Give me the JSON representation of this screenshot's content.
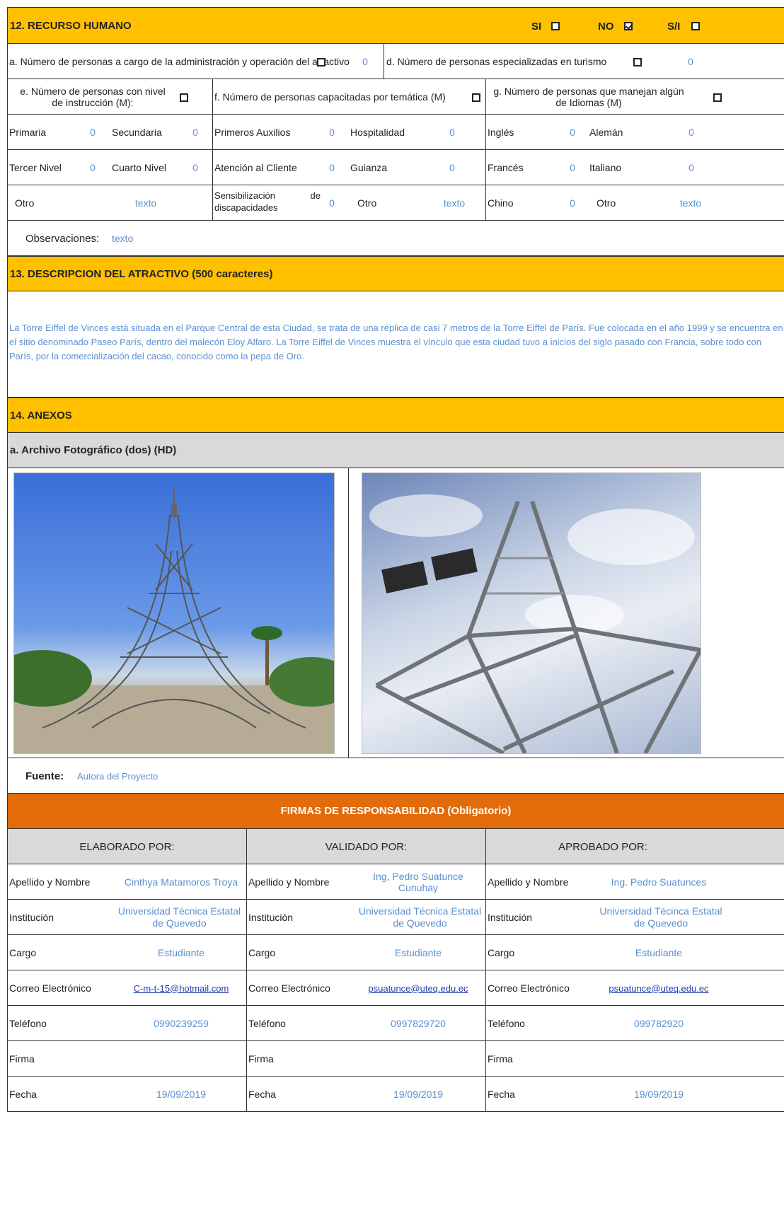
{
  "section12": {
    "title": "12. RECURSO HUMANO",
    "si_label": "SI",
    "no_label": "NO",
    "si_label_alt": "S/I"
  },
  "row_a": {
    "label_a": "a. Número de personas a cargo de la administración y operación del atractivo",
    "value_a": "0",
    "label_d": "d. Número de personas especializadas en turismo",
    "value_d": "0"
  },
  "row_efg": {
    "label_e": "e. Número de personas con nivel de instrucción (M):",
    "label_f": "f. Número de personas capacitadas por temática (M)",
    "label_g": "g. Número de personas que manejan algún de Idiomas (M)"
  },
  "grid": {
    "r1": [
      {
        "label": "Primaria",
        "value": "0"
      },
      {
        "label": "Secundaria",
        "value": "0"
      },
      {
        "label": "Primeros Auxilios",
        "value": "0"
      },
      {
        "label": "Hospitalidad",
        "value": "0"
      },
      {
        "label": "Inglés",
        "value": "0"
      },
      {
        "label": "Alemán",
        "value": "0"
      }
    ],
    "r2": [
      {
        "label": "Tercer Nivel",
        "value": "0"
      },
      {
        "label": "Cuarto Nivel",
        "value": "0"
      },
      {
        "label": "Atención al Cliente",
        "value": "0"
      },
      {
        "label": "Guianza",
        "value": "0"
      },
      {
        "label": "Francés",
        "value": "0"
      },
      {
        "label": "Italiano",
        "value": "0"
      }
    ],
    "r3": [
      {
        "label": "Otro",
        "value": "texto"
      },
      {
        "label": "Sensibilización de discapacidades",
        "value": "0"
      },
      {
        "label": "Otro",
        "value": "texto"
      },
      {
        "label": "Chino",
        "value": "0"
      },
      {
        "label": "Otro",
        "value": "texto"
      }
    ]
  },
  "observaciones": {
    "label": "Observaciones:",
    "value": "texto"
  },
  "section13": {
    "title": "13. DESCRIPCION DEL ATRACTIVO (500 caracteres)",
    "text": "La Torre Eiffel de Vinces está situada en el Parque Central de esta Ciudad, se trata de una réplica de casi 7 metros de la Torre Eiffel de París. Fue colocada en el año 1999 y se encuentra en el sitio denominado Paseo París, dentro del malecón Eloy Alfaro. La Torre Eiffel de Vinces muestra el vínculo que esta ciudad tuvo a inicios del siglo pasado con Francia, sobre todo con París, por la comercialización del cacao, conocido como la pepa de Oro."
  },
  "section14": {
    "title": "14. ANEXOS",
    "subtitle": "a. Archivo Fotográfico (dos) (HD)",
    "fuente_label": "Fuente:",
    "fuente_value": "Autora del Proyecto"
  },
  "firmas": {
    "title": "FIRMAS DE RESPONSABILIDAD (Obligatorio)",
    "columns": [
      {
        "header": "ELABORADO POR:",
        "nombre": "Cinthya Matamoros Troya",
        "institucion": "Universidad Técnica Estatal de Quevedo",
        "cargo": "Estudiante",
        "correo": "C-m-t-15@hotmail.com",
        "telefono": "0990239259",
        "fecha": "19/09/2019"
      },
      {
        "header": "VALIDADO  POR:",
        "nombre": "Ing, Pedro Suatunce Cunuhay",
        "institucion": "Universidad Técnica Estatal de Quevedo",
        "cargo": "Estudiante",
        "correo": "psuatunce@uteq.edu.ec",
        "telefono": "0997829720",
        "fecha": "19/09/2019"
      },
      {
        "header": "APROBADO POR:",
        "nombre": "Ing. Pedro Suatunces",
        "institucion": "Universidad Técinca Estatal de Quevedo",
        "cargo": "Estudiante",
        "correo": "psuatunce@uteq.edu.ec",
        "telefono": "099782920",
        "fecha": "19/09/2019"
      }
    ],
    "labels": {
      "nombre": "Apellido y Nombre",
      "institucion": "Institución",
      "cargo": "Cargo",
      "correo": "Correo Electrónico",
      "telefono": "Teléfono",
      "firma": "Firma",
      "fecha": "Fecha"
    }
  },
  "colors": {
    "section": "#ffc000",
    "firmas": "#e26b0a",
    "gray": "#d9d9d9",
    "value": "#5b8fd0"
  }
}
